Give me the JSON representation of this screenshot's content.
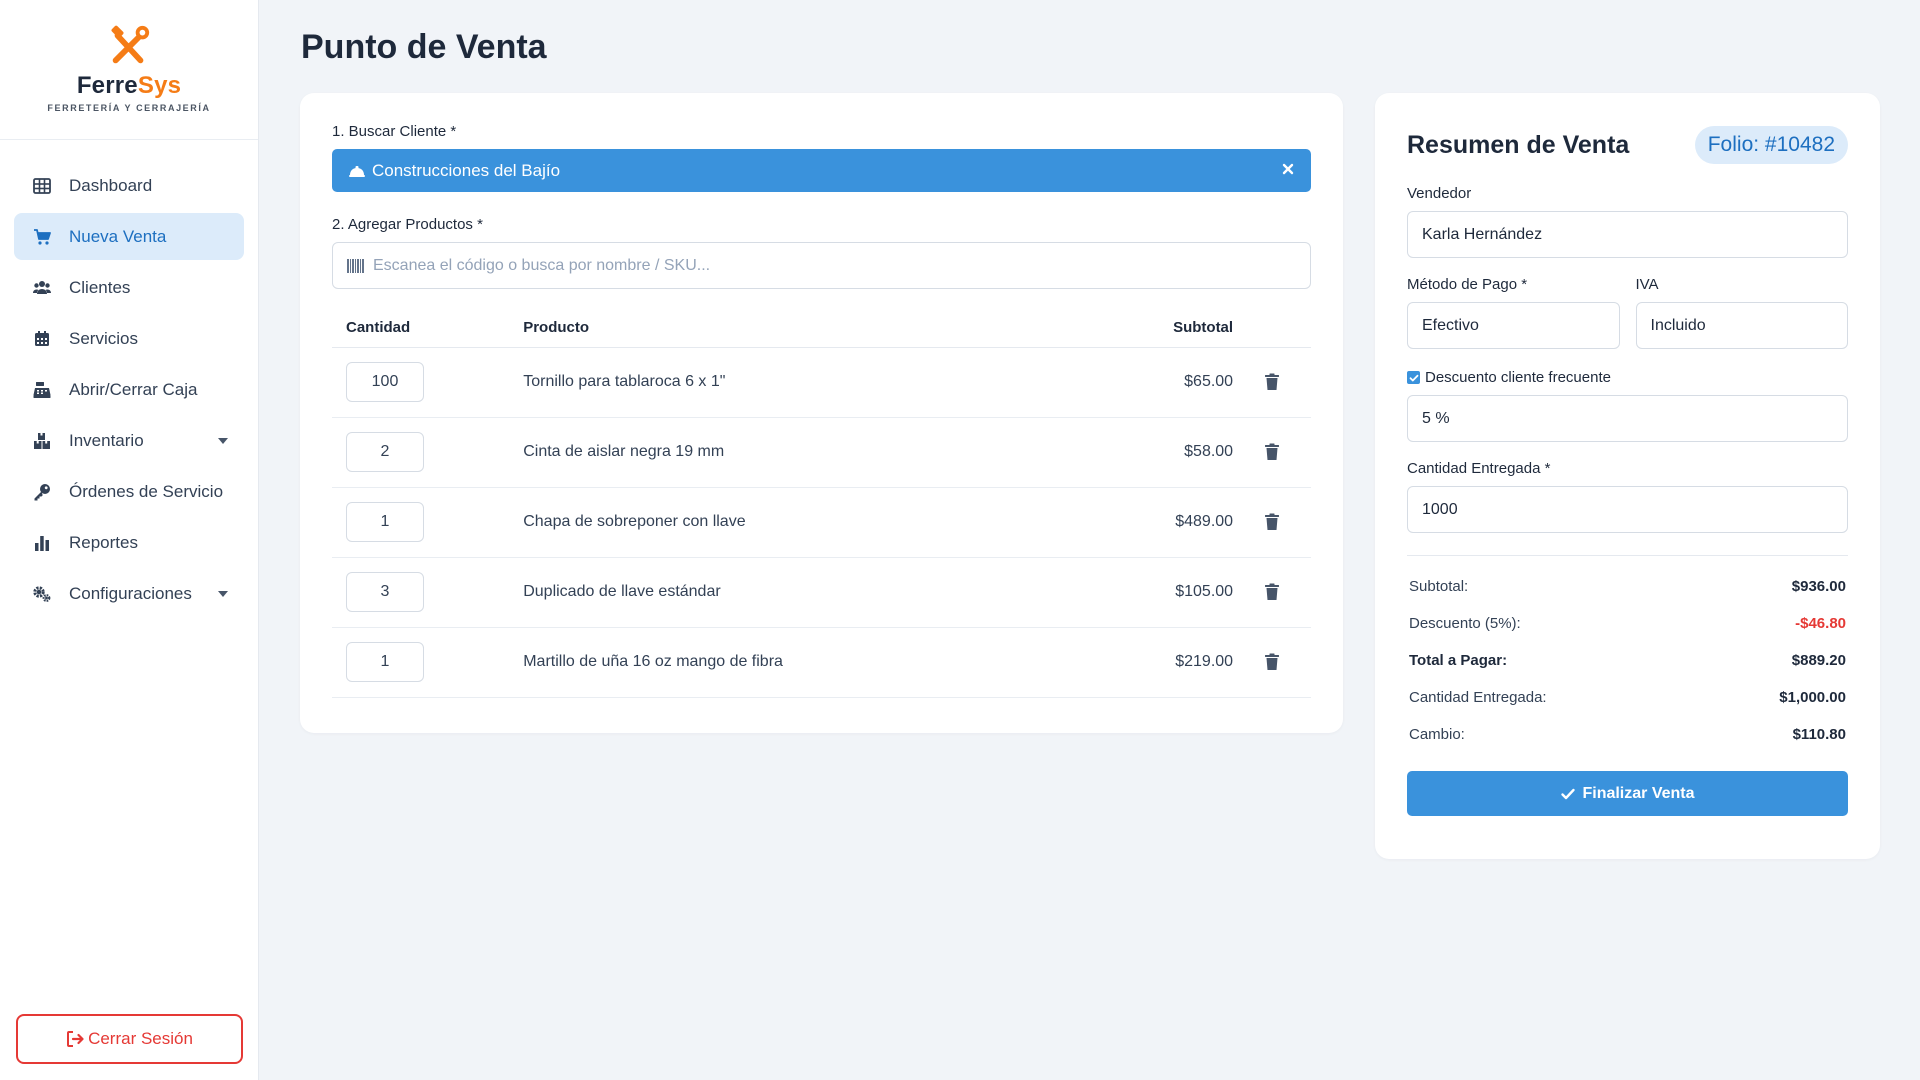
{
  "brand": {
    "name_part1": "Ferre",
    "name_part2": "Sys",
    "tagline": "FERRETERÍA Y CERRAJERÍA"
  },
  "sidebar": {
    "items": [
      {
        "label": "Dashboard",
        "icon": "table-icon"
      },
      {
        "label": "Nueva Venta",
        "icon": "cart-icon",
        "active": true
      },
      {
        "label": "Clientes",
        "icon": "users-icon"
      },
      {
        "label": "Servicios",
        "icon": "calendar-icon"
      },
      {
        "label": "Abrir/Cerrar Caja",
        "icon": "cash-register-icon"
      },
      {
        "label": "Inventario",
        "icon": "boxes-icon",
        "has_submenu": true
      },
      {
        "label": "Órdenes de Servicio",
        "icon": "key-icon"
      },
      {
        "label": "Reportes",
        "icon": "bar-chart-icon"
      },
      {
        "label": "Configuraciones",
        "icon": "gears-icon",
        "has_submenu": true
      }
    ],
    "logout_label": "Cerrar Sesión"
  },
  "page": {
    "title": "Punto de Venta"
  },
  "sale": {
    "client_label": "1. Buscar Cliente *",
    "client_selected": "Construcciones del Bajío",
    "products_label": "2. Agregar Productos *",
    "search_placeholder": "Escanea el código o busca por nombre / SKU...",
    "columns": {
      "qty": "Cantidad",
      "product": "Producto",
      "subtotal": "Subtotal"
    },
    "rows": [
      {
        "qty": "100",
        "product": "Tornillo para tablaroca 6 x 1\"",
        "subtotal": "$65.00"
      },
      {
        "qty": "2",
        "product": "Cinta de aislar negra 19 mm",
        "subtotal": "$58.00"
      },
      {
        "qty": "1",
        "product": "Chapa de sobreponer con llave",
        "subtotal": "$489.00"
      },
      {
        "qty": "3",
        "product": "Duplicado de llave estándar",
        "subtotal": "$105.00"
      },
      {
        "qty": "1",
        "product": "Martillo de uña 16 oz mango de fibra",
        "subtotal": "$219.00"
      }
    ]
  },
  "summary": {
    "title": "Resumen de Venta",
    "folio": "Folio: #10482",
    "seller_label": "Vendedor",
    "seller_value": "Karla Hernández",
    "payment_label": "Método de Pago *",
    "payment_value": "Efectivo",
    "iva_label": "IVA",
    "iva_value": "Incluido",
    "discount_check_label": "Descuento cliente frecuente",
    "discount_checked": true,
    "discount_value": "5 %",
    "delivered_label": "Cantidad Entregada *",
    "delivered_value": "1000",
    "totals": {
      "subtotal_label": "Subtotal:",
      "subtotal_value": "$936.00",
      "discount_label": "Descuento (5%):",
      "discount_value": "-$46.80",
      "total_label": "Total a Pagar:",
      "total_value": "$889.20",
      "delivered_label": "Cantidad Entregada:",
      "delivered_value": "$1,000.00",
      "change_label": "Cambio:",
      "change_value": "$110.80"
    },
    "finalize_label": "Finalizar Venta"
  },
  "colors": {
    "accent": "#3a92dc",
    "active_nav_bg": "#dcebfa",
    "brand_orange": "#f57c16",
    "danger": "#e53935"
  }
}
